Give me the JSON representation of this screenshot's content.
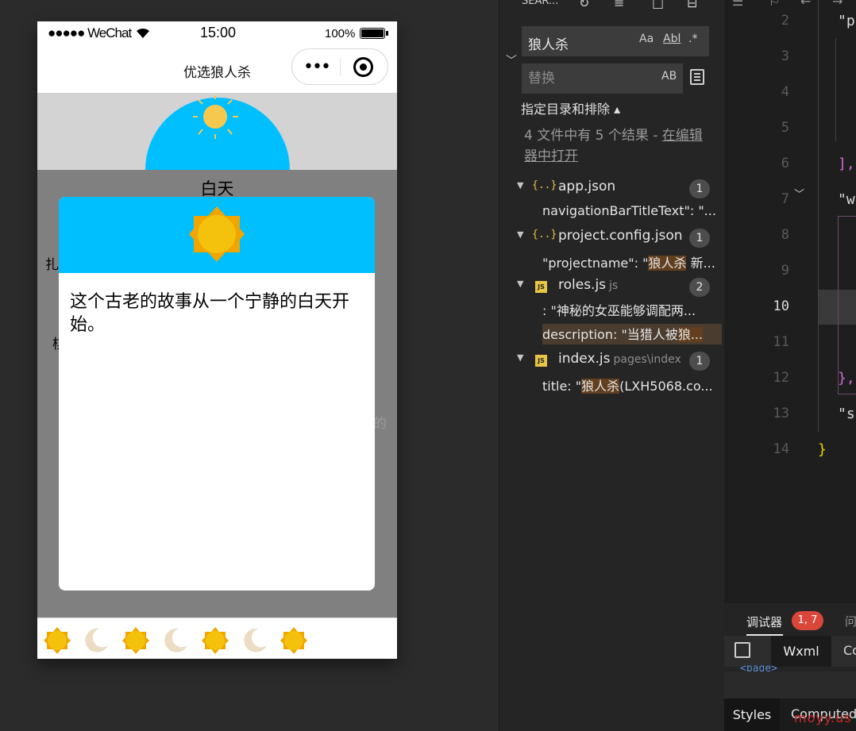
{
  "phone": {
    "status": {
      "signal": "●●●●● WeChat",
      "time": "15:00",
      "battery": "100%"
    },
    "nav_title": "优选狼人杀",
    "capsule_more": "•••",
    "phase_label": "白天",
    "side_chars": [
      "扎",
      "棋"
    ],
    "faint_text": "的",
    "modal_text": "这个古老的故事从一个宁静的白天开始。",
    "tabbar_icons": [
      "sun-icon",
      "moon-icon",
      "sun-icon",
      "moon-icon",
      "sun-icon",
      "moon-icon",
      "sun-icon"
    ],
    "colors": {
      "sky_gray": "#d3d3d3",
      "dome_blue": "#00bfff",
      "sun_yellow": "#f4c20d",
      "overlay_gray": "#808080"
    }
  },
  "search": {
    "header": "SEAR...",
    "query": "狼人杀",
    "options": [
      "Aa",
      "Abl",
      ".*"
    ],
    "replace_placeholder": "替换",
    "replace_option": "AB",
    "scope_label": "指定目录和排除 ▴",
    "summary": "4 文件中有 5 个结果 - ",
    "summary_link": "在编辑器中打开",
    "files": [
      {
        "name": "app.json",
        "dir": "",
        "type": "json",
        "count": "1",
        "matches": [
          {
            "pre": "navigationBarTitleText\": \"...",
            "hl": "",
            "post": ""
          }
        ]
      },
      {
        "name": "project.config.json",
        "dir": "",
        "type": "json",
        "count": "1",
        "matches": [
          {
            "pre": "\"projectname\": \"",
            "hl": "狼人杀",
            "post": " 新..."
          }
        ]
      },
      {
        "name": "roles.js",
        "dir": "js",
        "type": "js",
        "count": "2",
        "matches": [
          {
            "pre": ": \"神秘的女巫能够调配两...",
            "hl": "",
            "post": ""
          },
          {
            "pre": "description: \"当猎人被",
            "hl": "狼...",
            "post": ""
          }
        ]
      },
      {
        "name": "index.js",
        "dir": "pages\\index",
        "type": "js",
        "count": "1",
        "matches": [
          {
            "pre": "title: \"",
            "hl": "狼人杀",
            "post": "(LXH5068.co..."
          }
        ]
      }
    ]
  },
  "editor": {
    "lines": [
      {
        "num": "2",
        "code": "\"p"
      },
      {
        "num": "3",
        "code": ""
      },
      {
        "num": "4",
        "code": ""
      },
      {
        "num": "5",
        "code": ""
      },
      {
        "num": "6",
        "code": "],"
      },
      {
        "num": "7",
        "code": "\"w"
      },
      {
        "num": "8",
        "code": ""
      },
      {
        "num": "9",
        "code": ""
      },
      {
        "num": "10",
        "code": ""
      },
      {
        "num": "11",
        "code": ""
      },
      {
        "num": "12",
        "code": "},"
      },
      {
        "num": "13",
        "code": "\"s"
      },
      {
        "num": "14",
        "code": "}"
      }
    ],
    "active_line": "10"
  },
  "debugger": {
    "tab": "调试器",
    "errors": "1, 7",
    "next_tab": "问",
    "wxml_tab": "Wxml",
    "co_tab": "Co",
    "page_tag": "<page>",
    "styles_tab": "Styles",
    "computed_tab": "Computed"
  },
  "watermark": "moyy.us"
}
